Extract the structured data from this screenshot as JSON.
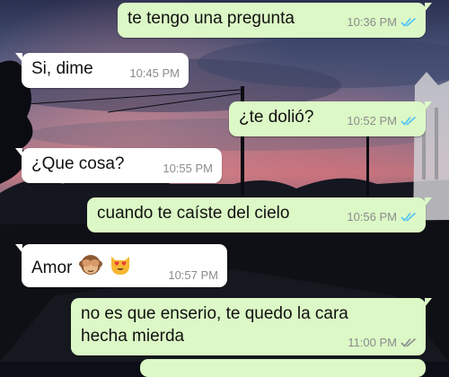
{
  "colors": {
    "outgoing_bubble": "#dcf8c6",
    "incoming_bubble": "#ffffff",
    "read_ticks": "#4fc3f7",
    "sent_ticks": "#8c8c8c",
    "timestamp": "#8c8c8c"
  },
  "messages": [
    {
      "direction": "out",
      "text": "te tengo una pregunta",
      "time": "10:36 PM",
      "status": "read",
      "status_icon": "double-check-blue-icon"
    },
    {
      "direction": "in",
      "text": "Si, dime",
      "time": "10:45 PM"
    },
    {
      "direction": "out",
      "text": "¿te dolió?",
      "time": "10:52 PM",
      "status": "read",
      "status_icon": "double-check-blue-icon"
    },
    {
      "direction": "in",
      "text": "¿Que cosa?",
      "time": "10:55 PM"
    },
    {
      "direction": "out",
      "text": "cuando te caíste del cielo",
      "time": "10:56 PM",
      "status": "read",
      "status_icon": "double-check-blue-icon"
    },
    {
      "direction": "in",
      "text": "Amor",
      "emojis": [
        "see-no-evil-monkey-icon",
        "heart-eyes-cat-icon"
      ],
      "time": "10:57 PM"
    },
    {
      "direction": "out",
      "lines": [
        "no es que enserio, te quedo la cara",
        "hecha mierda"
      ],
      "time": "11:00 PM",
      "status": "delivered",
      "status_icon": "double-check-grey-icon"
    }
  ]
}
